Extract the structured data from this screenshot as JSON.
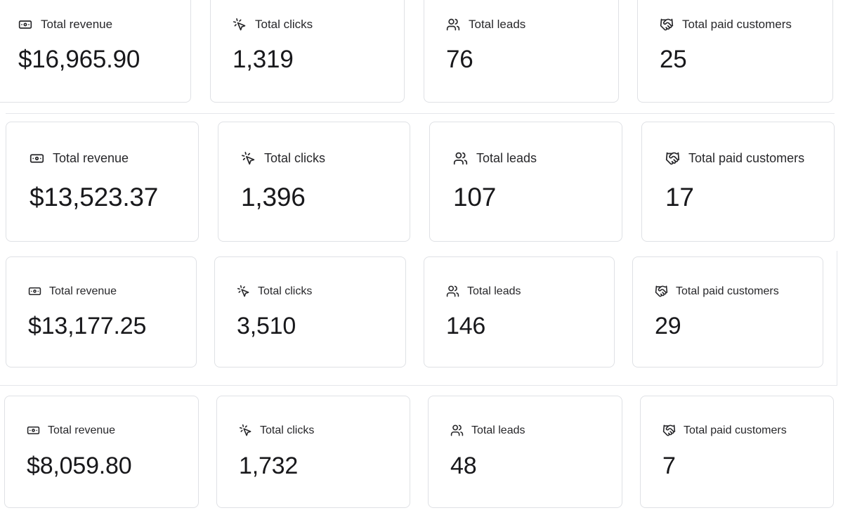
{
  "labels": {
    "revenue": "Total revenue",
    "clicks": "Total clicks",
    "leads": "Total leads",
    "customers": "Total paid customers"
  },
  "icons": {
    "revenue": "banknote-icon",
    "clicks": "mouse-pointer-click-icon",
    "leads": "users-icon",
    "customers": "handshake-icon"
  },
  "rows": [
    {
      "revenue": "$16,965.90",
      "clicks": "1,319",
      "leads": "76",
      "customers": "25"
    },
    {
      "revenue": "$13,523.37",
      "clicks": "1,396",
      "leads": "107",
      "customers": "17"
    },
    {
      "revenue": "$13,177.25",
      "clicks": "3,510",
      "leads": "146",
      "customers": "29"
    },
    {
      "revenue": "$8,059.80",
      "clicks": "1,732",
      "leads": "48",
      "customers": "7"
    }
  ],
  "colors": {
    "border": "#dfe1e5",
    "text": "#18181b",
    "label": "#27272a"
  }
}
